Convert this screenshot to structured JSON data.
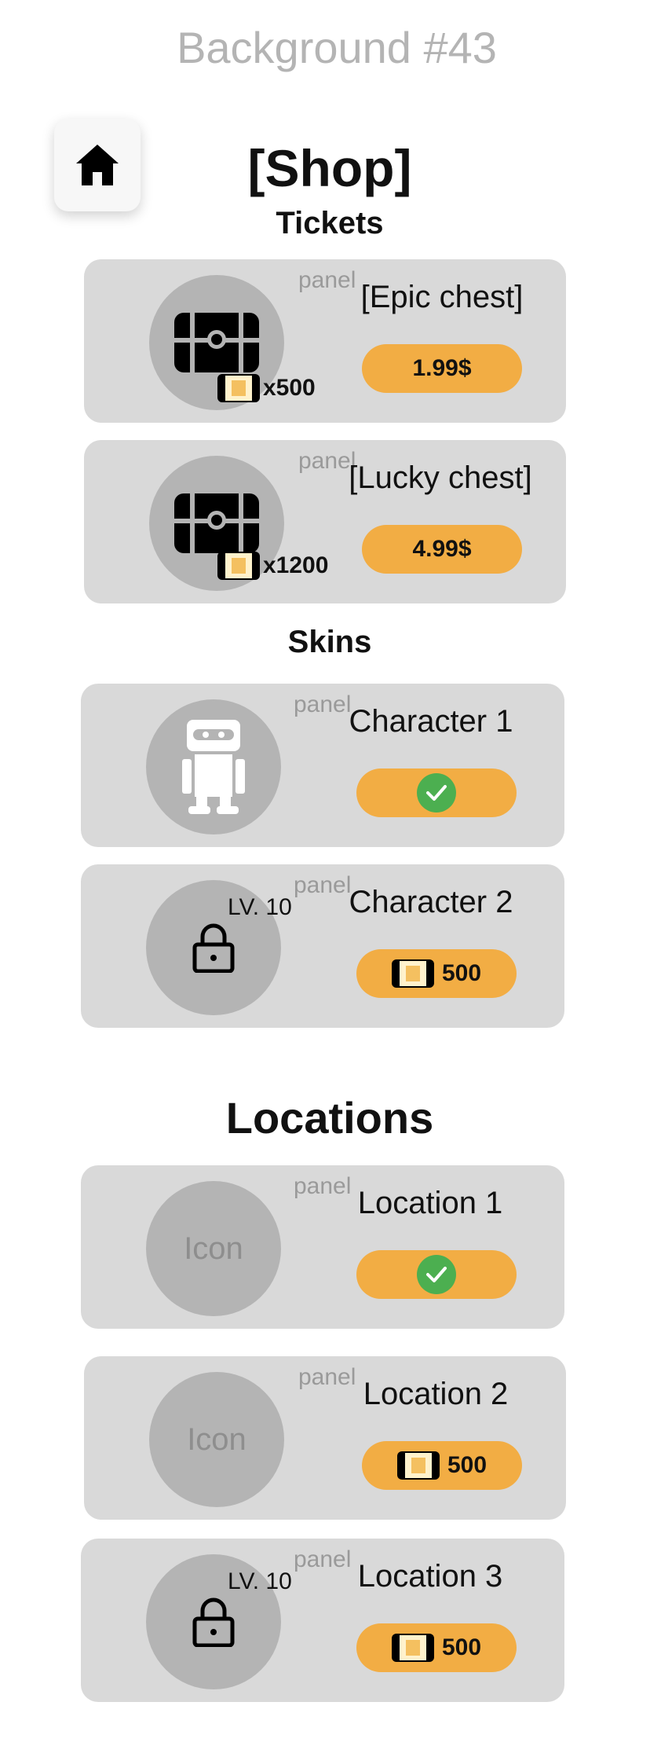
{
  "background_label": "Background #43",
  "header": {
    "title": "[Shop]"
  },
  "sections": {
    "tickets": "Tickets",
    "skins": "Skins",
    "locations": "Locations"
  },
  "panel_tag": "panel",
  "tickets": [
    {
      "title": "[Epic chest]",
      "quantity": "x500",
      "price": "1.99$"
    },
    {
      "title": "[Lucky chest]",
      "quantity": "x1200",
      "price": "4.99$"
    }
  ],
  "skins": [
    {
      "title": "Character 1",
      "state": "owned"
    },
    {
      "title": "Character 2",
      "level": "LV. 10",
      "price": "500"
    }
  ],
  "locations": [
    {
      "title": "Location 1",
      "icon_text": "Icon",
      "state": "owned"
    },
    {
      "title": "Location 2",
      "icon_text": "Icon",
      "price": "500"
    },
    {
      "title": "Location 3",
      "level": "LV. 10",
      "price": "500"
    }
  ],
  "colors": {
    "panel": "#d9d9d9",
    "circle": "#b4b4b4",
    "button": "#f2ad44",
    "check": "#4caf50"
  },
  "icons": [
    "home-icon",
    "chest-icon",
    "ticket-icon",
    "robot-icon",
    "lock-icon",
    "checkmark-icon"
  ]
}
